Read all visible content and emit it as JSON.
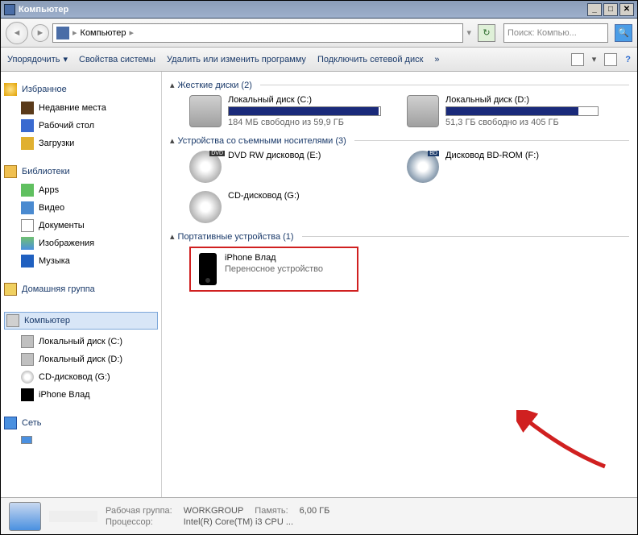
{
  "title": "Компьютер",
  "address": {
    "root": "Компьютер"
  },
  "search_placeholder": "Поиск: Компью...",
  "toolbar": {
    "organize": "Упорядочить",
    "properties": "Свойства системы",
    "uninstall": "Удалить или изменить программу",
    "map_drive": "Подключить сетевой диск",
    "more": "»"
  },
  "sidebar": {
    "favorites": {
      "label": "Избранное",
      "items": [
        {
          "icon": "ic-recent",
          "label": "Недавние места"
        },
        {
          "icon": "ic-desktop",
          "label": "Рабочий стол"
        },
        {
          "icon": "ic-down",
          "label": "Загрузки"
        }
      ]
    },
    "libraries": {
      "label": "Библиотеки",
      "items": [
        {
          "icon": "ic-apps",
          "label": "Apps"
        },
        {
          "icon": "ic-video",
          "label": "Видео"
        },
        {
          "icon": "ic-doc",
          "label": "Документы"
        },
        {
          "icon": "ic-img",
          "label": "Изображения"
        },
        {
          "icon": "ic-music",
          "label": "Музыка"
        }
      ]
    },
    "homegroup": {
      "label": "Домашняя группа"
    },
    "computer": {
      "label": "Компьютер",
      "items": [
        {
          "icon": "ic-hdd",
          "label": "Локальный диск (C:)"
        },
        {
          "icon": "ic-hdd",
          "label": "Локальный диск (D:)"
        },
        {
          "icon": "ic-cd",
          "label": "CD-дисковод (G:)"
        },
        {
          "icon": "ic-phone",
          "label": "iPhone Влад"
        }
      ]
    },
    "network": {
      "label": "Сеть"
    }
  },
  "groups": {
    "hdd": {
      "label": "Жесткие диски (2)",
      "items": [
        {
          "name": "Локальный диск (C:)",
          "fill": 99,
          "sub": "184 МБ свободно из 59,9 ГБ"
        },
        {
          "name": "Локальный диск (D:)",
          "fill": 87,
          "sub": "51,3 ГБ свободно из 405 ГБ"
        }
      ]
    },
    "removable": {
      "label": "Устройства со съемными носителями (3)",
      "items": [
        {
          "icon": "ic-dvd-lg",
          "name": "DVD RW дисковод (E:)"
        },
        {
          "icon": "ic-bd-lg",
          "name": "Дисковод BD-ROM (F:)"
        },
        {
          "icon": "ic-cd-lg",
          "name": "CD-дисковод (G:)"
        }
      ]
    },
    "portable": {
      "label": "Портативные устройства (1)",
      "name": "iPhone Влад",
      "sub": "Переносное устройство"
    }
  },
  "status": {
    "workgroup_label": "Рабочая группа:",
    "workgroup": "WORKGROUP",
    "memory_label": "Память:",
    "memory": "6,00 ГБ",
    "cpu_label": "Процессор:",
    "cpu": "Intel(R) Core(TM) i3 CPU  ..."
  }
}
